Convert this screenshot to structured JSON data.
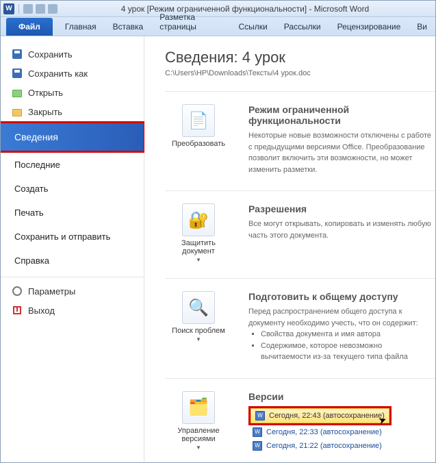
{
  "title": "4 урок [Режим ограниченной функциональности] - Microsoft Word",
  "ribbon": {
    "file": "Файл",
    "tabs": [
      "Главная",
      "Вставка",
      "Разметка страницы",
      "Ссылки",
      "Рассылки",
      "Рецензирование",
      "Ви"
    ]
  },
  "nav": {
    "save": "Сохранить",
    "saveas": "Сохранить как",
    "open": "Открыть",
    "close": "Закрыть",
    "info": "Сведения",
    "recent": "Последние",
    "new": "Создать",
    "print": "Печать",
    "sendshare": "Сохранить и отправить",
    "help": "Справка",
    "options": "Параметры",
    "exit": "Выход"
  },
  "info": {
    "title": "Сведения: 4 урок",
    "path": "C:\\Users\\HP\\Downloads\\Тексты\\4 урок.doc"
  },
  "sections": {
    "convert": {
      "btn": "Преобразовать",
      "h": "Режим ограниченной функциональности",
      "p": "Некоторые новые возможности отключены с работе с предыдущими версиями Office. Преобразование позволит включить эти возможности, но может изменить разметки."
    },
    "protect": {
      "btn": "Защитить документ",
      "h": "Разрешения",
      "p": "Все могут открывать, копировать и изменять любую часть этого документа."
    },
    "prepare": {
      "btn": "Поиск проблем",
      "h": "Подготовить к общему доступу",
      "p": "Перед распространением общего доступа к документу необходимо учесть, что он содержит:",
      "li1": "Свойства документа и имя автора",
      "li2": "Содержимое, которое невозможно вычитаемости из-за текущего типа файла"
    },
    "versions": {
      "btn": "Управление версиями",
      "h": "Версии",
      "v1": "Сегодня, 22:43 (автосохранение)",
      "v2": "Сегодня, 22:33 (автосохранение)",
      "v3": "Сегодня, 21:22 (автосохранение)"
    }
  }
}
